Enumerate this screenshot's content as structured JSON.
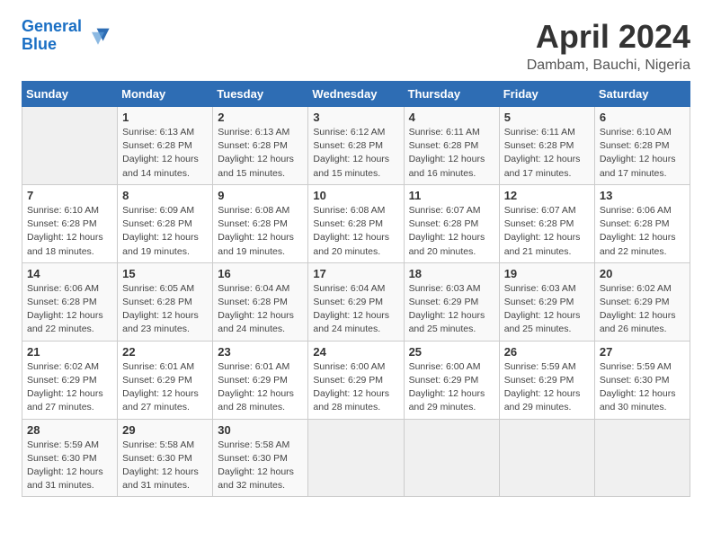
{
  "logo": {
    "line1": "General",
    "line2": "Blue"
  },
  "title": "April 2024",
  "subtitle": "Dambam, Bauchi, Nigeria",
  "weekdays": [
    "Sunday",
    "Monday",
    "Tuesday",
    "Wednesday",
    "Thursday",
    "Friday",
    "Saturday"
  ],
  "weeks": [
    [
      {
        "date": "",
        "info": ""
      },
      {
        "date": "1",
        "info": "Sunrise: 6:13 AM\nSunset: 6:28 PM\nDaylight: 12 hours\nand 14 minutes."
      },
      {
        "date": "2",
        "info": "Sunrise: 6:13 AM\nSunset: 6:28 PM\nDaylight: 12 hours\nand 15 minutes."
      },
      {
        "date": "3",
        "info": "Sunrise: 6:12 AM\nSunset: 6:28 PM\nDaylight: 12 hours\nand 15 minutes."
      },
      {
        "date": "4",
        "info": "Sunrise: 6:11 AM\nSunset: 6:28 PM\nDaylight: 12 hours\nand 16 minutes."
      },
      {
        "date": "5",
        "info": "Sunrise: 6:11 AM\nSunset: 6:28 PM\nDaylight: 12 hours\nand 17 minutes."
      },
      {
        "date": "6",
        "info": "Sunrise: 6:10 AM\nSunset: 6:28 PM\nDaylight: 12 hours\nand 17 minutes."
      }
    ],
    [
      {
        "date": "7",
        "info": "Sunrise: 6:10 AM\nSunset: 6:28 PM\nDaylight: 12 hours\nand 18 minutes."
      },
      {
        "date": "8",
        "info": "Sunrise: 6:09 AM\nSunset: 6:28 PM\nDaylight: 12 hours\nand 19 minutes."
      },
      {
        "date": "9",
        "info": "Sunrise: 6:08 AM\nSunset: 6:28 PM\nDaylight: 12 hours\nand 19 minutes."
      },
      {
        "date": "10",
        "info": "Sunrise: 6:08 AM\nSunset: 6:28 PM\nDaylight: 12 hours\nand 20 minutes."
      },
      {
        "date": "11",
        "info": "Sunrise: 6:07 AM\nSunset: 6:28 PM\nDaylight: 12 hours\nand 20 minutes."
      },
      {
        "date": "12",
        "info": "Sunrise: 6:07 AM\nSunset: 6:28 PM\nDaylight: 12 hours\nand 21 minutes."
      },
      {
        "date": "13",
        "info": "Sunrise: 6:06 AM\nSunset: 6:28 PM\nDaylight: 12 hours\nand 22 minutes."
      }
    ],
    [
      {
        "date": "14",
        "info": "Sunrise: 6:06 AM\nSunset: 6:28 PM\nDaylight: 12 hours\nand 22 minutes."
      },
      {
        "date": "15",
        "info": "Sunrise: 6:05 AM\nSunset: 6:28 PM\nDaylight: 12 hours\nand 23 minutes."
      },
      {
        "date": "16",
        "info": "Sunrise: 6:04 AM\nSunset: 6:28 PM\nDaylight: 12 hours\nand 24 minutes."
      },
      {
        "date": "17",
        "info": "Sunrise: 6:04 AM\nSunset: 6:29 PM\nDaylight: 12 hours\nand 24 minutes."
      },
      {
        "date": "18",
        "info": "Sunrise: 6:03 AM\nSunset: 6:29 PM\nDaylight: 12 hours\nand 25 minutes."
      },
      {
        "date": "19",
        "info": "Sunrise: 6:03 AM\nSunset: 6:29 PM\nDaylight: 12 hours\nand 25 minutes."
      },
      {
        "date": "20",
        "info": "Sunrise: 6:02 AM\nSunset: 6:29 PM\nDaylight: 12 hours\nand 26 minutes."
      }
    ],
    [
      {
        "date": "21",
        "info": "Sunrise: 6:02 AM\nSunset: 6:29 PM\nDaylight: 12 hours\nand 27 minutes."
      },
      {
        "date": "22",
        "info": "Sunrise: 6:01 AM\nSunset: 6:29 PM\nDaylight: 12 hours\nand 27 minutes."
      },
      {
        "date": "23",
        "info": "Sunrise: 6:01 AM\nSunset: 6:29 PM\nDaylight: 12 hours\nand 28 minutes."
      },
      {
        "date": "24",
        "info": "Sunrise: 6:00 AM\nSunset: 6:29 PM\nDaylight: 12 hours\nand 28 minutes."
      },
      {
        "date": "25",
        "info": "Sunrise: 6:00 AM\nSunset: 6:29 PM\nDaylight: 12 hours\nand 29 minutes."
      },
      {
        "date": "26",
        "info": "Sunrise: 5:59 AM\nSunset: 6:29 PM\nDaylight: 12 hours\nand 29 minutes."
      },
      {
        "date": "27",
        "info": "Sunrise: 5:59 AM\nSunset: 6:30 PM\nDaylight: 12 hours\nand 30 minutes."
      }
    ],
    [
      {
        "date": "28",
        "info": "Sunrise: 5:59 AM\nSunset: 6:30 PM\nDaylight: 12 hours\nand 31 minutes."
      },
      {
        "date": "29",
        "info": "Sunrise: 5:58 AM\nSunset: 6:30 PM\nDaylight: 12 hours\nand 31 minutes."
      },
      {
        "date": "30",
        "info": "Sunrise: 5:58 AM\nSunset: 6:30 PM\nDaylight: 12 hours\nand 32 minutes."
      },
      {
        "date": "",
        "info": ""
      },
      {
        "date": "",
        "info": ""
      },
      {
        "date": "",
        "info": ""
      },
      {
        "date": "",
        "info": ""
      }
    ]
  ]
}
